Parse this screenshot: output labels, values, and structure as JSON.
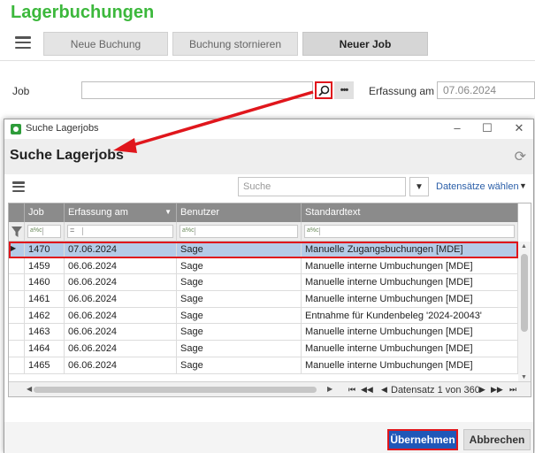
{
  "app": {
    "title": "Lagerbuchungen",
    "toolbar": {
      "new_booking": "Neue Buchung",
      "cancel_booking": "Buchung stornieren",
      "new_job": "Neuer Job"
    },
    "form": {
      "job_label": "Job",
      "job_value": "",
      "date_label": "Erfassung am",
      "date_value": "07.06.2024"
    }
  },
  "dialog": {
    "window_title": "Suche Lagerjobs",
    "heading": "Suche Lagerjobs",
    "search_placeholder": "Suche",
    "records_select": "Datensätze wählen",
    "columns": [
      "Job",
      "Erfassung am",
      "Benutzer",
      "Standardtext"
    ],
    "filter_placeholder": "a%c",
    "filter_equals": "=",
    "rows": [
      {
        "job": "1470",
        "date": "07.06.2024",
        "user": "Sage",
        "text": "Manuelle Zugangsbuchungen [MDE]",
        "selected": true
      },
      {
        "job": "1459",
        "date": "06.06.2024",
        "user": "Sage",
        "text": "Manuelle interne Umbuchungen [MDE]"
      },
      {
        "job": "1460",
        "date": "06.06.2024",
        "user": "Sage",
        "text": "Manuelle interne Umbuchungen [MDE]"
      },
      {
        "job": "1461",
        "date": "06.06.2024",
        "user": "Sage",
        "text": "Manuelle interne Umbuchungen [MDE]"
      },
      {
        "job": "1462",
        "date": "06.06.2024",
        "user": "Sage",
        "text": "Entnahme für Kundenbeleg '2024-20043'"
      },
      {
        "job": "1463",
        "date": "06.06.2024",
        "user": "Sage",
        "text": "Manuelle interne Umbuchungen [MDE]"
      },
      {
        "job": "1464",
        "date": "06.06.2024",
        "user": "Sage",
        "text": "Manuelle interne Umbuchungen [MDE]"
      },
      {
        "job": "1465",
        "date": "06.06.2024",
        "user": "Sage",
        "text": "Manuelle interne Umbuchungen [MDE]"
      }
    ],
    "pager": "Datensatz 1 von 360",
    "buttons": {
      "ok": "Übernehmen",
      "cancel": "Abbrechen"
    }
  },
  "icons": {
    "menu": "hamburger-icon",
    "search": "search-icon",
    "more": "ellipsis-icon",
    "refresh": "refresh-icon",
    "filter": "funnel-icon",
    "callout_arrow": "red-arrow"
  },
  "colors": {
    "title_green": "#3cb83c",
    "highlight_red": "#e0161c",
    "primary_button": "#1f57b8",
    "selected_row": "#b4cbe7",
    "grid_header": "#8b8b8b"
  }
}
